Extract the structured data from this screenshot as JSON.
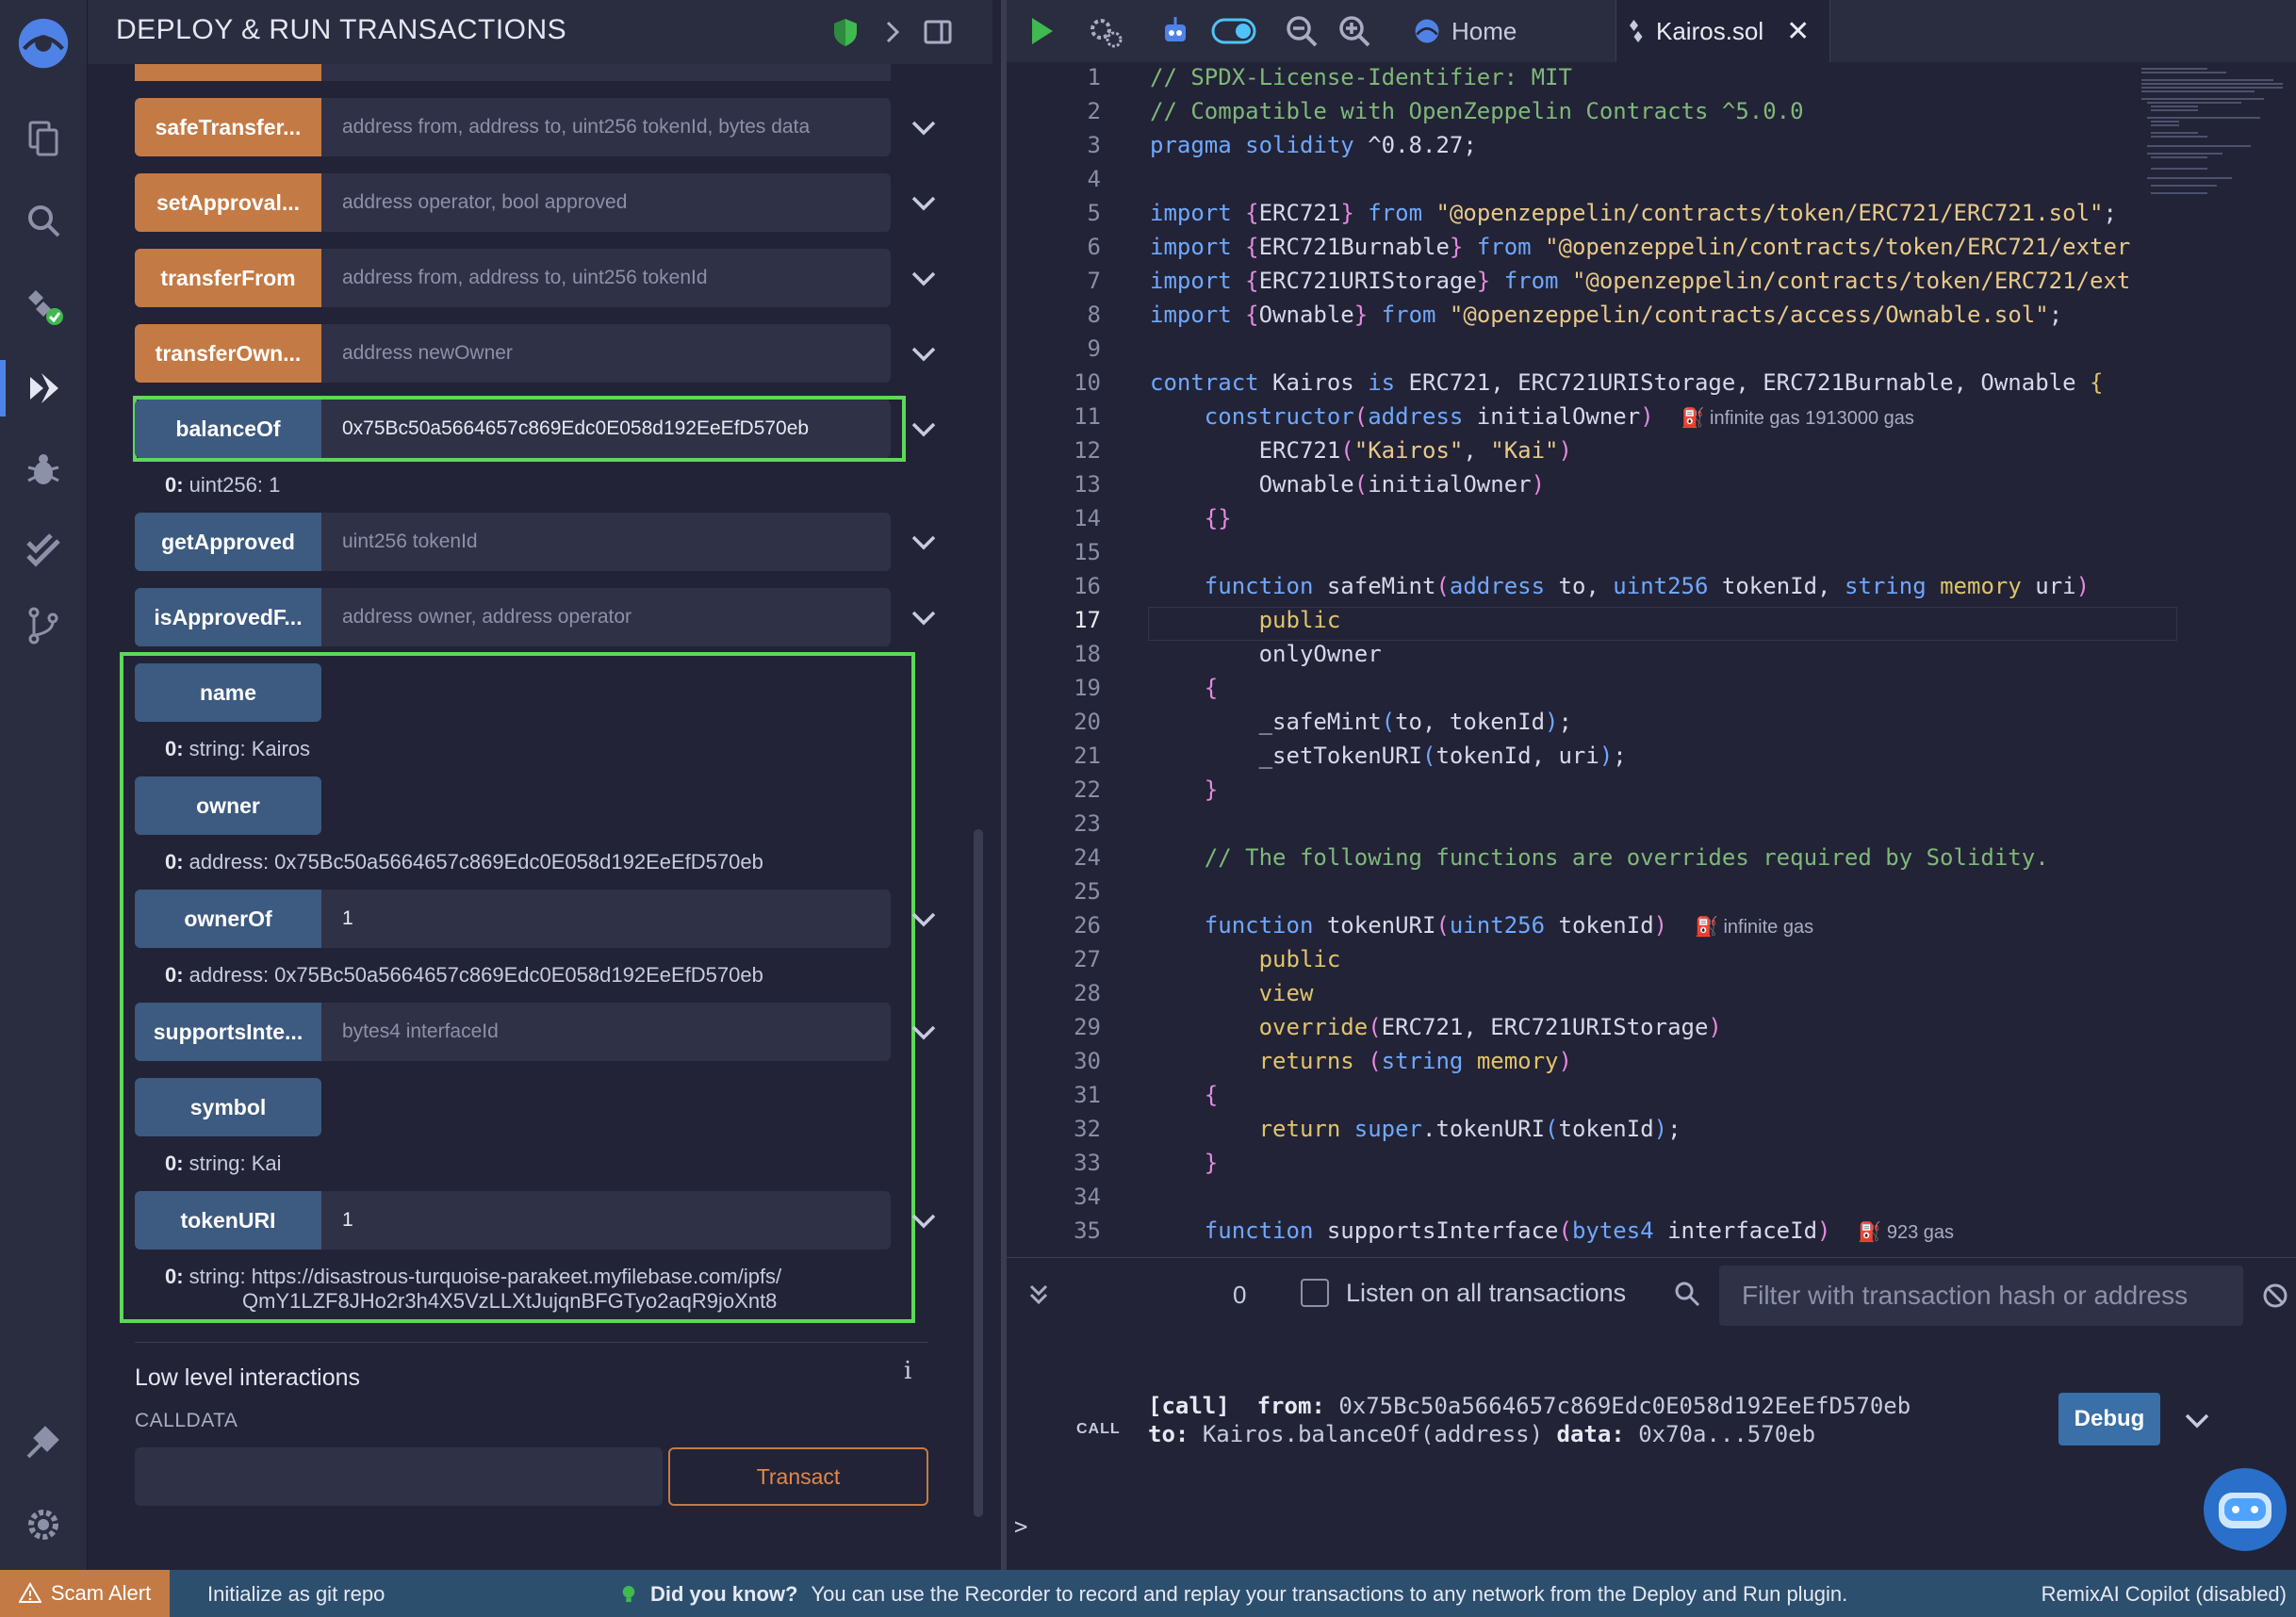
{
  "panel": {
    "title": "DEPLOY & RUN TRANSACTIONS"
  },
  "functions": [
    {
      "label": "safeTransfer...",
      "input": "address from, address to, uint256 tokenId, bytes data",
      "color": "orange"
    },
    {
      "label": "setApproval...",
      "input": "address operator, bool approved",
      "color": "orange"
    },
    {
      "label": "transferFrom",
      "input": "address from, address to, uint256 tokenId",
      "color": "orange"
    },
    {
      "label": "transferOwn...",
      "input": "address newOwner",
      "color": "orange"
    },
    {
      "label": "balanceOf",
      "input": "0x75Bc50a5664657c869Edc0E058d192EeEfD570eb",
      "result": "0: uint256: 1",
      "color": "blue"
    },
    {
      "label": "getApproved",
      "input": "uint256 tokenId",
      "color": "blue"
    },
    {
      "label": "isApprovedF...",
      "input": "address owner, address operator",
      "color": "blue"
    },
    {
      "label": "name",
      "result": "0: string: Kairos",
      "color": "blue"
    },
    {
      "label": "owner",
      "result": "0: address: 0x75Bc50a5664657c869Edc0E058d192EeEfD570eb",
      "color": "blue"
    },
    {
      "label": "ownerOf",
      "input": "1",
      "result": "0: address: 0x75Bc50a5664657c869Edc0E058d192EeEfD570eb",
      "color": "blue"
    },
    {
      "label": "supportsInte...",
      "input": "bytes4 interfaceId",
      "color": "blue"
    },
    {
      "label": "symbol",
      "result": "0: string: Kai",
      "color": "blue"
    },
    {
      "label": "tokenURI",
      "input": "1",
      "result_line1": "0: string: https://disastrous-turquoise-parakeet.myfilebase.com/ipfs/",
      "result_line2": "QmY1LZF8JHo2r3h4X5VzLLXtJujqnBFGTyo2aqR9joXnt8",
      "color": "blue"
    }
  ],
  "low_level": {
    "title": "Low level interactions",
    "info": "i",
    "calldata_label": "CALLDATA",
    "transact_label": "Transact"
  },
  "tabs": {
    "home": "Home",
    "file": "Kairos.sol",
    "close": "✕"
  },
  "code": {
    "current_line": 17,
    "line_numbers": [
      "1",
      "2",
      "3",
      "4",
      "5",
      "6",
      "7",
      "8",
      "9",
      "10",
      "11",
      "12",
      "13",
      "14",
      "15",
      "16",
      "17",
      "18",
      "19",
      "20",
      "21",
      "22",
      "23",
      "24",
      "25",
      "26",
      "27",
      "28",
      "29",
      "30",
      "31",
      "32",
      "33",
      "34",
      "35"
    ],
    "gas_constructor": "infinite gas 1913000 gas",
    "gas_tokenuri": "infinite gas",
    "gas_supports": "923 gas"
  },
  "terminal": {
    "count": "0",
    "listen_label": "Listen on all transactions",
    "filter_placeholder": "Filter with transaction hash or address",
    "call_label": "CALL",
    "call_line1_tag": "[call]",
    "call_line1_from_label": "from:",
    "call_line1_from": "0x75Bc50a5664657c869Edc0E058d192EeEfD570eb",
    "call_line2_to_label": "to:",
    "call_line2_to": "Kairos.balanceOf(address)",
    "call_line2_data_label": "data:",
    "call_line2_data": "0x70a...570eb",
    "debug_label": "Debug",
    "prompt": ">"
  },
  "statusbar": {
    "scam_alert": "Scam Alert",
    "git_init": "Initialize as git repo",
    "dyk_title": "Did you know?",
    "dyk_text": "You can use the Recorder to record and replay your transactions to any network from the Deploy and Run plugin.",
    "copilot": "RemixAI Copilot (disabled)"
  },
  "colors": {
    "accent_green": "#5fd85a",
    "orange": "#c47a45",
    "blue": "#3d5a80",
    "statusbar": "#2d4f6e"
  }
}
